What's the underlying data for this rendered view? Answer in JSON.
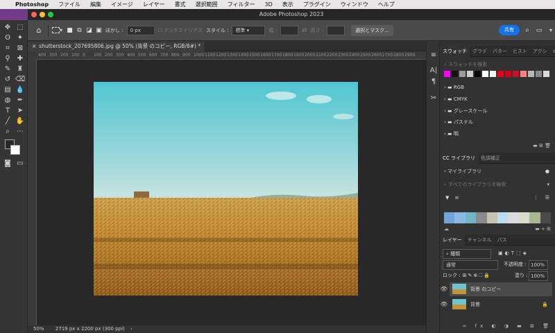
{
  "mac_menu": {
    "app": "Photoshop",
    "items": [
      "ファイル",
      "編集",
      "イメージ",
      "レイヤー",
      "書式",
      "選択範囲",
      "フィルター",
      "3D",
      "表示",
      "プラグイン",
      "ウィンドウ",
      "ヘルプ"
    ]
  },
  "window": {
    "title": "Adobe Photoshop 2023"
  },
  "options": {
    "blur_label": "ぼかし :",
    "blur_value": "0 px",
    "antialias_label": "アンチエイリアス",
    "style_label": "スタイル :",
    "style_value": "標準",
    "width_label": "幅 :",
    "height_label": "高さ :",
    "select_mask_label": "選択とマスク...",
    "share_label": "共有"
  },
  "document": {
    "tab_title": "shutterstock_207695806.jpg @ 50% (背景 のコピー, RGB/8#) *",
    "ruler_ticks": [
      "400",
      "350",
      "300",
      "250",
      "200",
      "150",
      "100",
      "50",
      "0",
      "50",
      "100",
      "150",
      "200",
      "250",
      "300",
      "350",
      "400",
      "450",
      "500",
      "550",
      "600",
      "650",
      "700",
      "750",
      "800",
      "850",
      "900",
      "950",
      "1000",
      "1050",
      "1100",
      "1150",
      "1200",
      "1250",
      "1300",
      "1350",
      "1400",
      "1450",
      "1500",
      "1550",
      "1600",
      "1650",
      "1700",
      "1750",
      "1800",
      "1850",
      "1900",
      "1950",
      "2000",
      "2050",
      "2100",
      "2150",
      "2200",
      "2250",
      "2300",
      "2350",
      "2400",
      "2450",
      "2500",
      "2550",
      "2600",
      "2650",
      "2700",
      "2750",
      "2800",
      "2850",
      "2900",
      "2950",
      "3000",
      "3050",
      "3100",
      "3150",
      "3200"
    ]
  },
  "status": {
    "zoom": "50%",
    "doc_info": "2719 px x 2200 px (300 ppi)"
  },
  "swatches_panel": {
    "tabs": [
      "スウォッチ",
      "グラデ",
      "パター",
      "ヒスト",
      "アクシ"
    ],
    "search_placeholder": "スウォッチを検索",
    "colors": [
      "#ff00ff",
      "#111111",
      "#9a9a9a",
      "#cfcfcf",
      "#000000",
      "#ffffff",
      "#ffffff",
      "#e8001c",
      "#d4001c",
      "#c8102e",
      "#ff7f7f",
      "#b8b8b8",
      "#8a8a8a",
      "#dcdcdc"
    ],
    "groups": [
      "RGB",
      "CMYK",
      "グレースケール",
      "パステル",
      "明"
    ]
  },
  "library_panel": {
    "tabs": [
      "CC ライブラリ",
      "色調補正"
    ],
    "library_name": "マイライブラリ",
    "search_placeholder": "すべてのライブラリを検索",
    "theme_colors": [
      "#6ea6d8",
      "#8db8e0",
      "#6fb6c8",
      "#8a8a8a",
      "#c8c2b0",
      "#bcdcf0",
      "#dcdcdc",
      "#d8dcc8",
      "#a8b890",
      "#4a4a4a"
    ]
  },
  "layers_panel": {
    "tabs": [
      "レイヤー",
      "チャンネル",
      "パス"
    ],
    "filter_value": "種類",
    "blend_mode": "通常",
    "opacity_label": "不透明度 :",
    "opacity_value": "100%",
    "lock_label": "ロック :",
    "fill_label": "塗り :",
    "fill_value": "100%",
    "layers": [
      {
        "name": "背景 のコピー",
        "selected": true
      },
      {
        "name": "背景",
        "selected": false
      }
    ]
  }
}
